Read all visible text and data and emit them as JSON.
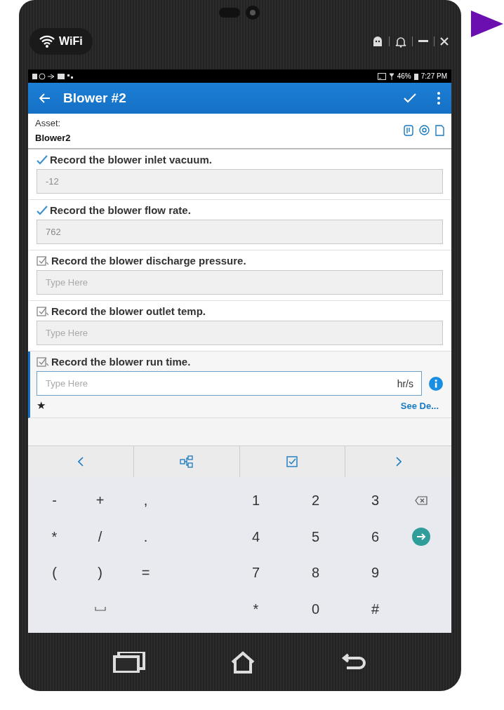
{
  "wifi_badge": {
    "label": "WiFi"
  },
  "status_bar": {
    "battery": "46%",
    "time": "7:27 PM"
  },
  "app_bar": {
    "title": "Blower #2"
  },
  "asset": {
    "label": "Asset:",
    "value": "Blower2"
  },
  "tasks": [
    {
      "title": "Record the blower inlet vacuum.",
      "done": true,
      "value": "-12",
      "active": false
    },
    {
      "title": "Record the blower flow rate.",
      "done": true,
      "value": "762",
      "active": false
    },
    {
      "title": "Record the blower discharge pressure.",
      "done": false,
      "placeholder": "Type Here",
      "active": false
    },
    {
      "title": "Record the blower outlet temp.",
      "done": false,
      "placeholder": "Type Here",
      "active": false
    },
    {
      "title": "Record the blower run time.",
      "done": false,
      "placeholder": "Type Here",
      "unit": "hr/s",
      "active": true,
      "required_mark": "★",
      "details_link": "See De..."
    }
  ],
  "keypad": {
    "rows": [
      [
        {
          "kind": "char",
          "label": "-"
        },
        {
          "kind": "char",
          "label": "+"
        },
        {
          "kind": "char",
          "label": ","
        },
        {
          "kind": "char",
          "label": "1"
        },
        {
          "kind": "char",
          "label": "2"
        },
        {
          "kind": "char",
          "label": "3"
        },
        {
          "kind": "backspace"
        }
      ],
      [
        {
          "kind": "char",
          "label": "*"
        },
        {
          "kind": "char",
          "label": "/"
        },
        {
          "kind": "char",
          "label": "."
        },
        {
          "kind": "char",
          "label": "4"
        },
        {
          "kind": "char",
          "label": "5"
        },
        {
          "kind": "char",
          "label": "6"
        },
        {
          "kind": "enter"
        }
      ],
      [
        {
          "kind": "char",
          "label": "("
        },
        {
          "kind": "char",
          "label": ")"
        },
        {
          "kind": "char",
          "label": "="
        },
        {
          "kind": "char",
          "label": "7"
        },
        {
          "kind": "char",
          "label": "8"
        },
        {
          "kind": "char",
          "label": "9"
        },
        {
          "kind": "empty"
        }
      ],
      [
        {
          "kind": "empty"
        },
        {
          "kind": "space"
        },
        {
          "kind": "empty"
        },
        {
          "kind": "char",
          "label": "*"
        },
        {
          "kind": "char",
          "label": "0"
        },
        {
          "kind": "char",
          "label": "#"
        },
        {
          "kind": "empty"
        }
      ]
    ]
  }
}
